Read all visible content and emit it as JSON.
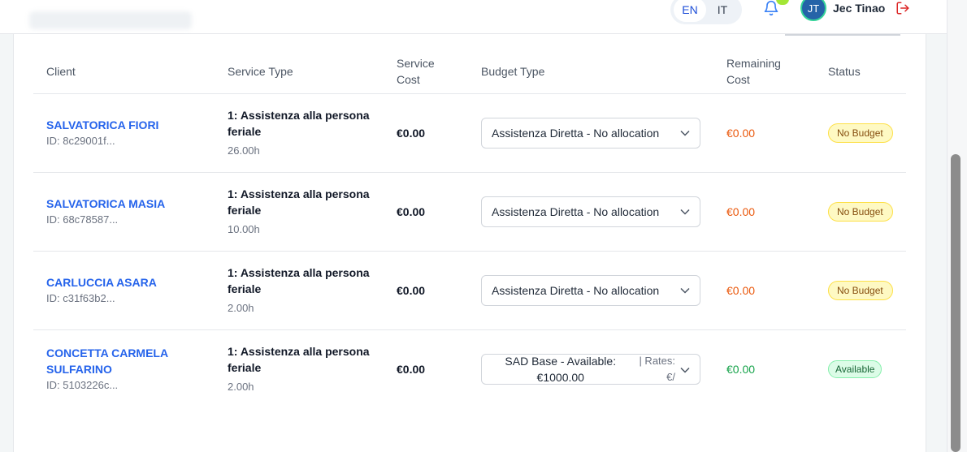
{
  "header": {
    "languages": [
      {
        "code": "EN",
        "active": true
      },
      {
        "code": "IT",
        "active": false
      }
    ],
    "user": {
      "initials": "JT",
      "name": "Jec Tinao"
    }
  },
  "table": {
    "columns": {
      "client": "Client",
      "service_type": "Service Type",
      "service_cost": "Service Cost",
      "budget_type": "Budget Type",
      "remaining_cost": "Remaining Cost",
      "status": "Status"
    },
    "rows": [
      {
        "client_name": "SALVATORICA FIORI",
        "client_id": "ID: 8c29001f...",
        "service_name": "1: Assistenza alla persona feriale",
        "hours": "26.00h",
        "service_cost": "€0.00",
        "budget_value": "Assistenza Diretta - No allocation",
        "remaining": "€0.00",
        "status": "No Budget"
      },
      {
        "client_name": "SALVATORICA MASIA",
        "client_id": "ID: 68c78587...",
        "service_name": "1: Assistenza alla persona feriale",
        "hours": "10.00h",
        "service_cost": "€0.00",
        "budget_value": "Assistenza Diretta - No allocation",
        "remaining": "€0.00",
        "status": "No Budget"
      },
      {
        "client_name": "CARLUCCIA ASARA",
        "client_id": "ID: c31f63b2...",
        "service_name": "1: Assistenza alla persona feriale",
        "hours": "2.00h",
        "service_cost": "€0.00",
        "budget_value": "Assistenza Diretta - No allocation",
        "remaining": "€0.00",
        "status": "No Budget"
      },
      {
        "client_name": "CONCETTA CARMELA SULFARINO",
        "client_id": "ID: 5103226c...",
        "service_name": "1: Assistenza alla persona feriale",
        "hours": "2.00h",
        "service_cost": "€0.00",
        "budget_value_main": "SAD Base - Available: €1000.00",
        "budget_value_rates": "| Rates: €/",
        "remaining": "€0.00",
        "status": "Available"
      }
    ]
  },
  "colors": {
    "link": "#2563eb",
    "remaining_negative": "#ea580c",
    "remaining_positive": "#16a34a",
    "badge_warning_bg": "#fef9c3",
    "badge_success_bg": "#dcfce7"
  },
  "icons": [
    "bell-icon",
    "logout-icon",
    "chevron-down-icon"
  ]
}
